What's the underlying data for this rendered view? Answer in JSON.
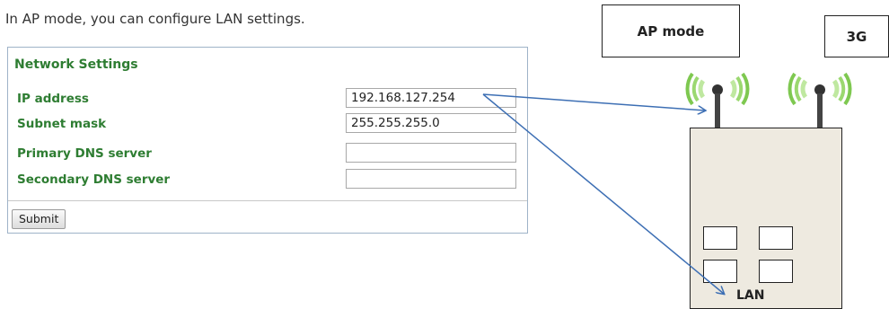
{
  "intro_text": "In AP mode, you can configure LAN settings.",
  "network_settings": {
    "title": "Network Settings",
    "fields": [
      {
        "label": "IP address",
        "value": "192.168.127.254"
      },
      {
        "label": "Subnet mask",
        "value": "255.255.255.0"
      },
      {
        "label": "Primary DNS server",
        "value": ""
      },
      {
        "label": "Secondary DNS server",
        "value": ""
      }
    ],
    "submit_label": "Submit"
  },
  "diagram": {
    "ap_mode_label": "AP mode",
    "cellular_label": "3G",
    "lan_label": "LAN"
  },
  "colors": {
    "label_green": "#2e7d32",
    "arrow_blue": "#3d6fb4",
    "signal_green": "#7ec850",
    "device_fill": "#eeeae0"
  }
}
